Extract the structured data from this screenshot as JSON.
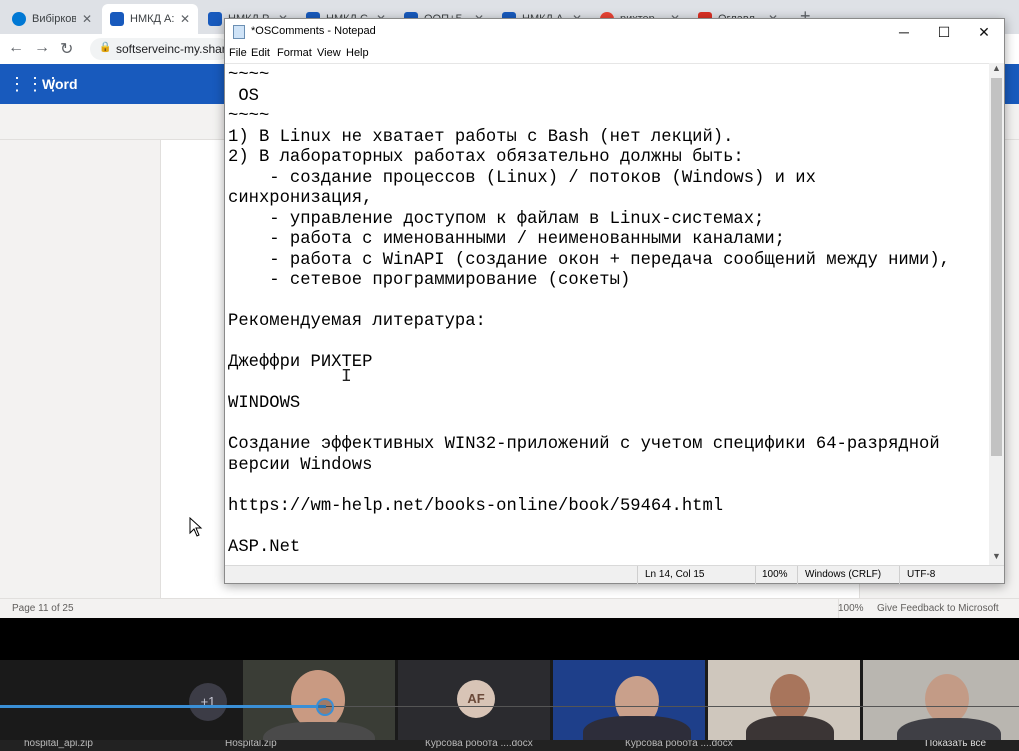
{
  "browser": {
    "tabs": [
      {
        "label": "Вибірков",
        "favicon_color": "#0078d4",
        "active": false
      },
      {
        "label": "НМКД А:",
        "favicon_color": "#185abd",
        "active": true
      },
      {
        "label": "НМКД Р",
        "favicon_color": "#185abd",
        "active": false
      },
      {
        "label": "НМКД С",
        "favicon_color": "#185abd",
        "active": false
      },
      {
        "label": "ООП+Б",
        "favicon_color": "#185abd",
        "active": false
      },
      {
        "label": "НМКД А",
        "favicon_color": "#185abd",
        "active": false
      },
      {
        "label": "рихтер",
        "favicon_color": "#ea4335",
        "active": false
      },
      {
        "label": "Оглавл",
        "favicon_color": "#d93025",
        "active": false
      }
    ],
    "new_tab": "+",
    "url": "softserveinc-my.shar"
  },
  "word": {
    "app_name": "Word",
    "page_count": "Page 11 of 25",
    "zoom": "100%",
    "feedback": "Give Feedback to Microsoft"
  },
  "notepad": {
    "title": "*OSComments - Notepad",
    "menu": [
      "File",
      "Edit",
      "Format",
      "View",
      "Help"
    ],
    "text": "~~~~\n OS\n~~~~\n1) В Linux не хватает работы с Bash (нет лекций).\n2) В лабораторных работах обязательно должны быть:\n    - создание процессов (Linux) / потоков (Windows) и их\nсинхронизация,\n    - управление доступом к файлам в Linux-системах;\n    - работа с именованными / неименованными каналами;\n    - работа с WinAPI (создание окон + передача сообщений между ними),\n    - сетевое программирование (сокеты)\n\nРекомендуемая литература:\n\nДжеффри РИХТЕР\n\nWINDOWS\n\nСоздание эффективных WIN32-приложений с учетом специфики 64-разрядной\nверсии Windows\n\nhttps://wm-help.net/books-online/book/59464.html\n\nASP.Net",
    "status": {
      "position": "Ln 14, Col 15",
      "zoom": "100%",
      "line_ending": "Windows (CRLF)",
      "encoding": "UTF-8"
    }
  },
  "call": {
    "more_participants": "+1",
    "participant_initials": "AF",
    "playback_progress_fraction": 0.32,
    "taskbar_items": [
      "hospital_api.zip",
      "Hospital.zip",
      "Курсова робота ....docx",
      "Курсова робота ....docx"
    ],
    "show_all": "Показать все"
  }
}
